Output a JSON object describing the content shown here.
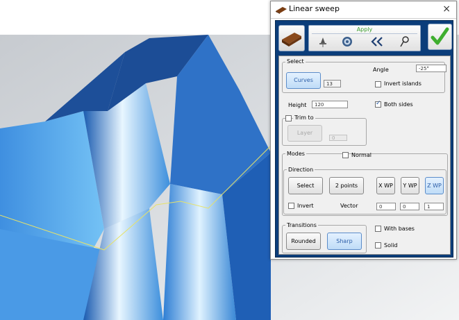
{
  "window": {
    "title": "Linear sweep",
    "close_glyph": "×"
  },
  "toolbar": {
    "apply_label": "Apply",
    "icons": [
      "sweep-tool-icon",
      "pin-icon",
      "gear-icon",
      "double-chevron-left-icon",
      "search-icon",
      "checkmark-icon"
    ]
  },
  "select": {
    "group_label": "Select",
    "curves_button": "Curves",
    "curves_count": "13",
    "angle_label": "Angle",
    "angle_value": "-25°",
    "invert_islands_label": "Invert islands",
    "invert_islands_checked": false
  },
  "height": {
    "label": "Height",
    "value": "120",
    "both_sides_label": "Both sides",
    "both_sides_checked": true
  },
  "trim": {
    "label": "Trim to",
    "checked": false,
    "button_label": "Layer",
    "field_value": "0"
  },
  "modes": {
    "group_label": "Modes",
    "normal_label": "Normal",
    "normal_checked": false,
    "direction": {
      "group_label": "Direction",
      "buttons": [
        "Select",
        "2 points",
        "X WP",
        "Y WP",
        "Z WP"
      ],
      "active_button": "Z WP",
      "invert_label": "Invert",
      "invert_checked": false,
      "vector_label": "Vector",
      "vector": [
        "0",
        "0",
        "1"
      ]
    }
  },
  "transitions": {
    "group_label": "Transitions",
    "buttons": [
      "Rounded",
      "Sharp"
    ],
    "active_button": "Sharp",
    "with_bases_label": "With bases",
    "with_bases_checked": false,
    "solid_label": "Solid",
    "solid_checked": false
  },
  "colors": {
    "dialog_header": "#0b3d7a",
    "model_dark": "#1d4f99",
    "model_light": "#5fb4f2",
    "background": "#cfd3d8",
    "edge_line": "#e6e26a",
    "accent": "#2a5da8"
  }
}
